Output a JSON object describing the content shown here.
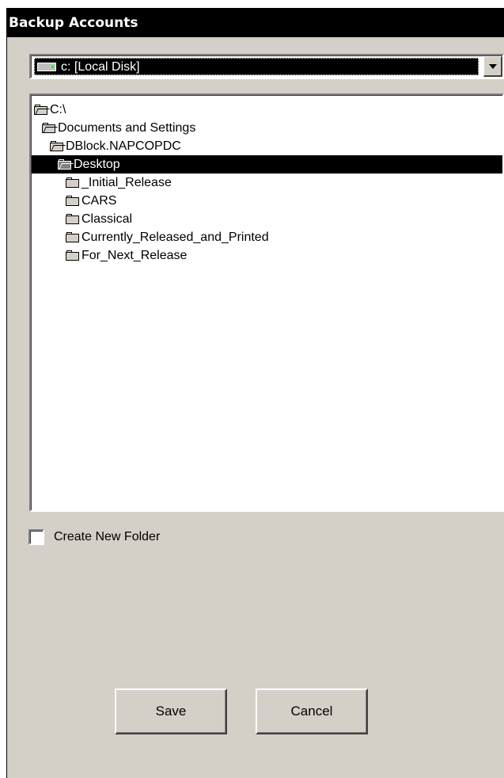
{
  "window": {
    "title": "Backup Accounts"
  },
  "drive_selector": {
    "value": "c: [Local Disk]",
    "icon": "drive-icon"
  },
  "folder_tree": {
    "items": [
      {
        "label": "C:\\",
        "indent": 0,
        "open": true,
        "selected": false
      },
      {
        "label": "Documents and Settings",
        "indent": 1,
        "open": true,
        "selected": false
      },
      {
        "label": "DBlock.NAPCOPDC",
        "indent": 2,
        "open": true,
        "selected": false
      },
      {
        "label": "Desktop",
        "indent": 3,
        "open": true,
        "selected": true
      },
      {
        "label": "_Initial_Release",
        "indent": 4,
        "open": false,
        "selected": false
      },
      {
        "label": "CARS",
        "indent": 4,
        "open": false,
        "selected": false
      },
      {
        "label": "Classical",
        "indent": 4,
        "open": false,
        "selected": false
      },
      {
        "label": "Currently_Released_and_Printed",
        "indent": 4,
        "open": false,
        "selected": false
      },
      {
        "label": "For_Next_Release",
        "indent": 4,
        "open": false,
        "selected": false
      }
    ]
  },
  "create_folder": {
    "label": "Create New Folder",
    "checked": false
  },
  "buttons": {
    "save": "Save",
    "cancel": "Cancel"
  },
  "colors": {
    "selection": "#000000",
    "face": "#d4d0c8",
    "titlebar": "#000000"
  }
}
